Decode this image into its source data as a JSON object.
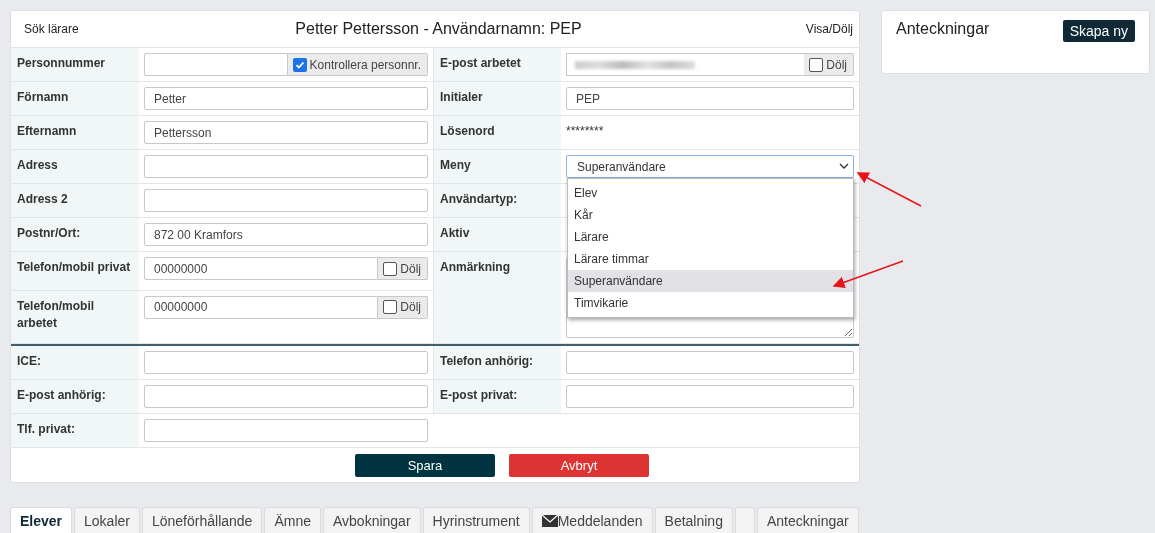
{
  "header": {
    "search_link": "Sök lärare",
    "title": "Petter Pettersson - Användarnamn: PEP",
    "toggle_link": "Visa/Dölj"
  },
  "sections": [
    {
      "rows": [
        {
          "left": {
            "label": "Personnummer",
            "kind": "text",
            "addon": {
              "label": "Kontrollera personnr.",
              "checked": true
            }
          },
          "right": {
            "label": "E-post arbetet",
            "kind": "redacted",
            "addon": {
              "label": "Dölj",
              "checked": false
            }
          }
        },
        {
          "left": {
            "label": "Förnamn",
            "kind": "text",
            "value": "Petter"
          },
          "right": {
            "label": "Initialer",
            "kind": "text",
            "value": "PEP"
          }
        },
        {
          "left": {
            "label": "Efternamn",
            "kind": "text",
            "value": "Pettersson"
          },
          "right": {
            "label": "Lösenord",
            "kind": "static",
            "value": "********"
          }
        },
        {
          "left": {
            "label": "Adress",
            "kind": "text"
          },
          "right": {
            "label": "Meny",
            "kind": "select",
            "value": "Superanvändare",
            "open": true,
            "options": [
              {
                "label": "Elev",
                "selected": false
              },
              {
                "label": "Kår",
                "selected": false
              },
              {
                "label": "Lärare",
                "selected": false
              },
              {
                "label": "Lärare timmar",
                "selected": false
              },
              {
                "label": "Superanvändare",
                "selected": true
              },
              {
                "label": "Timvikarie",
                "selected": false
              }
            ]
          }
        },
        {
          "left": {
            "label": "Adress 2",
            "kind": "text"
          },
          "right": {
            "label": "Användartyp:",
            "kind": "static"
          }
        },
        {
          "left": {
            "label": "Postnr/Ort:",
            "kind": "text",
            "value": "872 00 Kramfors"
          },
          "right": {
            "label": "Aktiv",
            "kind": "static"
          }
        },
        {
          "left": {
            "label": "Telefon/mobil privat",
            "kind": "text",
            "value": "00000000",
            "addon": {
              "label": "Dölj",
              "checked": false
            }
          },
          "right": {
            "label": "Anmärkning",
            "kind": "textarea"
          }
        },
        {
          "left": {
            "label": "Telefon/mobil arbetet",
            "kind": "text",
            "value": "00000000",
            "addon": {
              "label": "Dölj",
              "checked": false
            }
          }
        }
      ]
    },
    {
      "rows": [
        {
          "left": {
            "label": "ICE:",
            "kind": "text"
          },
          "right": {
            "label": "Telefon anhörig:",
            "kind": "text"
          }
        },
        {
          "left": {
            "label": "E-post anhörig:",
            "kind": "text"
          },
          "right": {
            "label": "E-post privat:",
            "kind": "text"
          }
        },
        {
          "left": {
            "label": "Tlf. privat:",
            "kind": "text"
          }
        }
      ]
    }
  ],
  "buttons": [
    {
      "label": "Spara",
      "kind": "primary"
    },
    {
      "label": "Avbryt",
      "kind": "danger"
    }
  ],
  "tabs": [
    {
      "label": "Elever",
      "selected": true
    },
    {
      "label": "Lokaler",
      "selected": false
    },
    {
      "label": "Löneförhållande",
      "selected": false
    },
    {
      "label": "Ämne",
      "selected": false
    },
    {
      "label": "Avbokningar",
      "selected": false
    },
    {
      "label": "Hyrinstrument",
      "selected": false
    },
    {
      "label": "Meddelanden",
      "selected": false,
      "kind": "mail"
    },
    {
      "label": "Betalning",
      "selected": false
    },
    {
      "selected": false
    },
    {
      "label": "Anteckningar",
      "selected": false
    }
  ],
  "notes": {
    "title": "Anteckningar",
    "button": "Skapa ny"
  }
}
